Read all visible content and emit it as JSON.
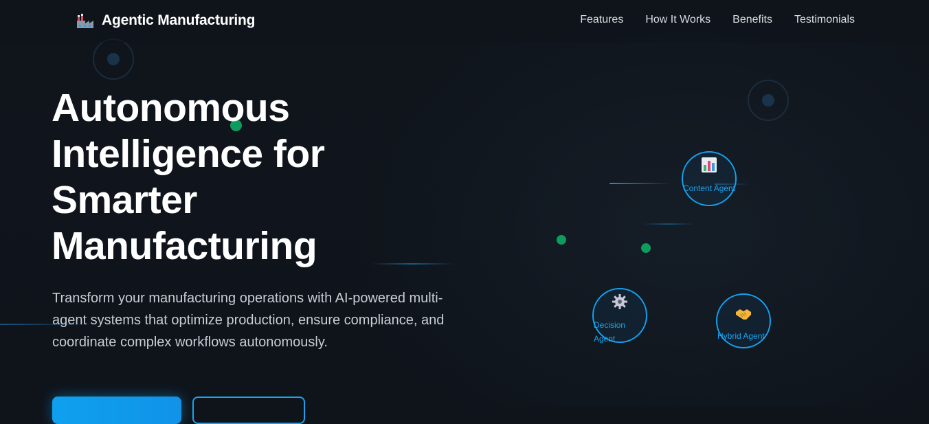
{
  "header": {
    "logo_text": "Agentic Manufacturing",
    "nav": [
      {
        "label": "Features"
      },
      {
        "label": "How It Works"
      },
      {
        "label": "Benefits"
      },
      {
        "label": "Testimonials"
      }
    ]
  },
  "hero": {
    "title_lines": [
      "Autonomous",
      "Intelligence for",
      "Smarter",
      "Manufacturing"
    ],
    "subtitle": "Transform your manufacturing operations with AI-powered multi-agent systems that optimize production, ensure compliance, and coordinate complex workflows autonomously."
  },
  "agents": [
    {
      "label": "Content Agent",
      "icon": "bar-chart-icon"
    },
    {
      "label": "Decision Agent",
      "icon": "gear-icon"
    },
    {
      "label": "Hybrid Agent",
      "icon": "handshake-icon"
    }
  ],
  "colors": {
    "background": "#0f141b",
    "accent": "#14a0ee",
    "green_dot": "#0e9b5e",
    "text_muted": "#c8cdd4"
  }
}
